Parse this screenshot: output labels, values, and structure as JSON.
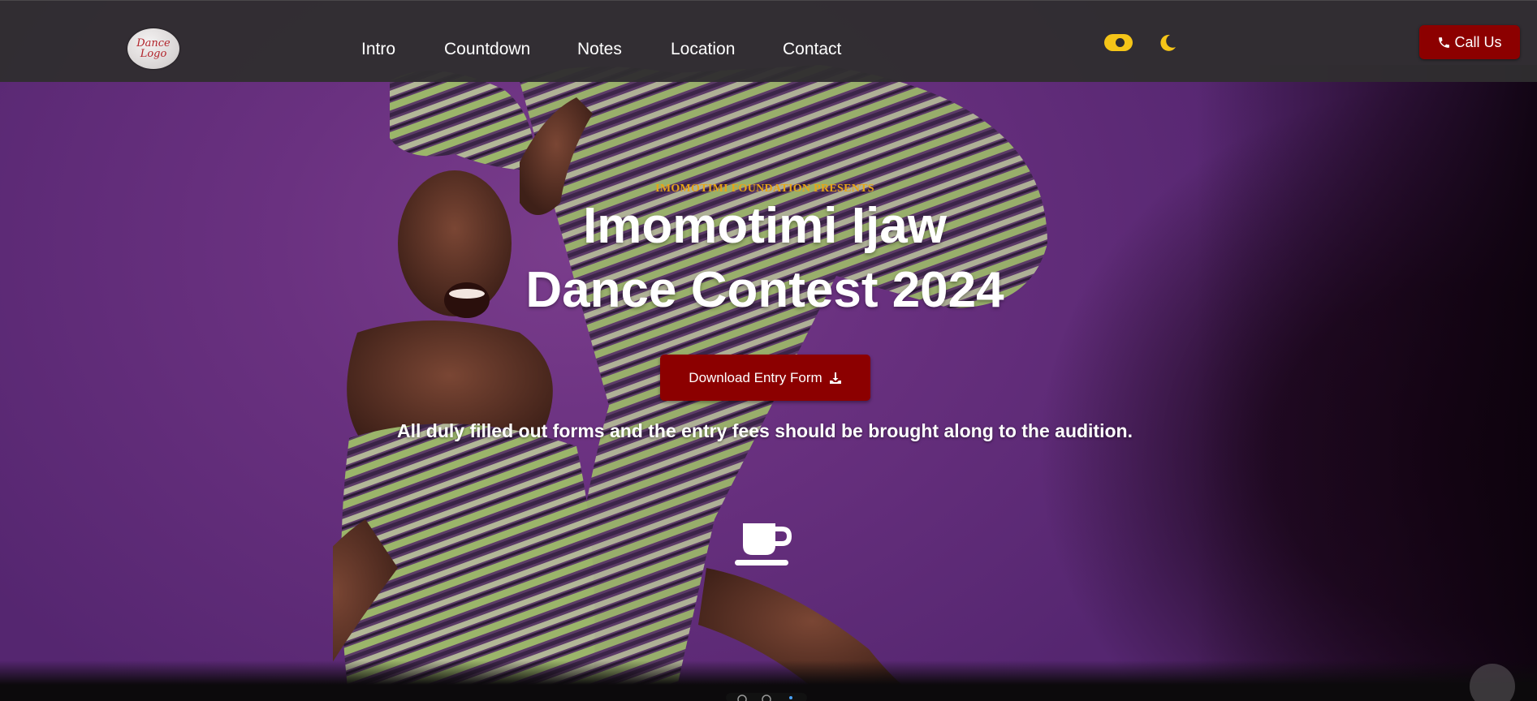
{
  "navbar": {
    "logo_text_line1": "Dance",
    "logo_text_line2": "Logo",
    "links": [
      {
        "label": "Intro"
      },
      {
        "label": "Countdown"
      },
      {
        "label": "Notes"
      },
      {
        "label": "Location"
      },
      {
        "label": "Contact"
      }
    ],
    "theme_toggle_icon": "toggle-on-icon",
    "theme_mode_icon": "moon-icon",
    "call_button": {
      "label": "Call Us",
      "icon": "phone-icon"
    }
  },
  "hero": {
    "presents": "IMOMOTIMI FOUNDATION PRESENTS",
    "title_line1": "Imomotimi Ijaw",
    "title_line2": "Dance Contest 2024",
    "download_button": {
      "label": "Download Entry Form",
      "icon": "download-icon"
    },
    "note": "All duly filled out forms and the entry fees should be brought along to the audition.",
    "decorative_icon": "coffee-cup-icon"
  },
  "colors": {
    "navbar_bg": "#302e30",
    "accent_red": "#8c0000",
    "accent_gold": "#e7a417",
    "toggle_yellow": "#f5c518",
    "hero_purple": "#6a3180"
  }
}
